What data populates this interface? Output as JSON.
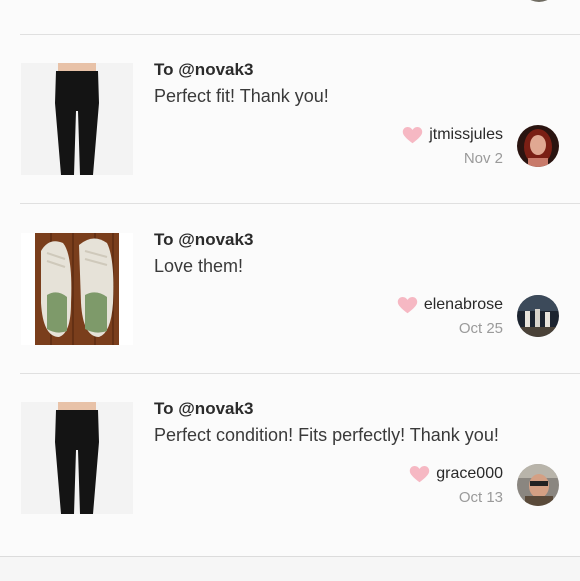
{
  "reviews": [
    {
      "to": "To @novak3",
      "comment": "Perfect fit! Thank you!",
      "username": "jtmissjules",
      "date": "Nov 2",
      "product_icon": "leggings-image",
      "avatar_icon": "user-avatar"
    },
    {
      "to": "To @novak3",
      "comment": "Love them!",
      "username": "elenabrose",
      "date": "Oct 25",
      "product_icon": "sneakers-image",
      "avatar_icon": "user-avatar"
    },
    {
      "to": "To @novak3",
      "comment": "Perfect condition! Fits perfectly! Thank you!",
      "username": "grace000",
      "date": "Oct 13",
      "product_icon": "leggings-image",
      "avatar_icon": "user-avatar"
    }
  ],
  "colors": {
    "heart": "#f6b8c3",
    "divider": "#e0e0e0",
    "date_text": "#9a9a9a"
  }
}
